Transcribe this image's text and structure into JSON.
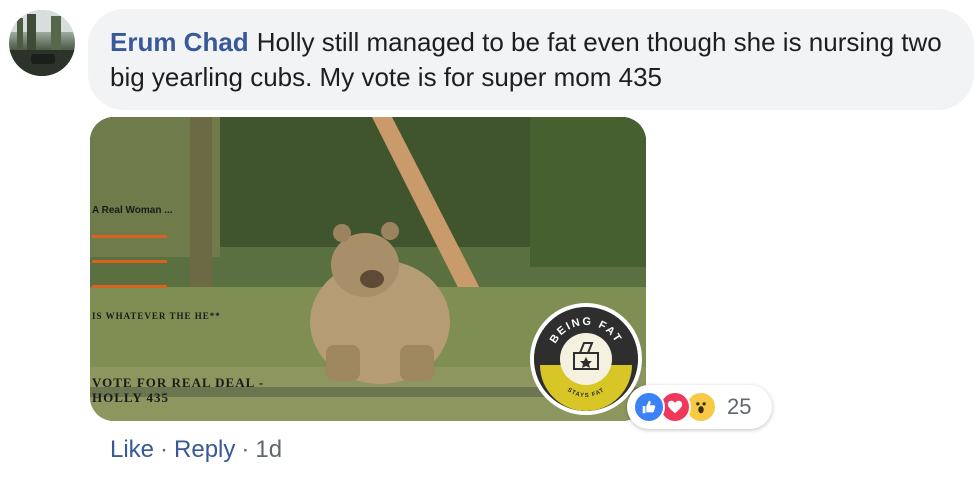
{
  "comment": {
    "author": "Erum Chad",
    "text": "Holly still managed to be fat even though she is nursing two big yearling cubs. My vote is for super mom 435"
  },
  "image": {
    "caption_line1": "A Real Woman ...",
    "caption_line2": "IS WHATEVER THE HE**",
    "caption_line3a": "VOTE FOR REAL DEAL -",
    "caption_line3b": "HOLLY 435",
    "badge_text_top": "BEING FAT",
    "badge_text_bottom": "STAYS FAT"
  },
  "reactions": {
    "icons": [
      "like-icon",
      "love-icon",
      "wow-icon"
    ],
    "count": "25"
  },
  "actions": {
    "like": "Like",
    "reply": "Reply",
    "separator": "·",
    "timestamp": "1d"
  },
  "colors": {
    "author": "#385898",
    "bubble_bg": "#f2f3f5",
    "like": "#3b82f6",
    "love": "#f0395a",
    "wow": "#f7c944"
  }
}
